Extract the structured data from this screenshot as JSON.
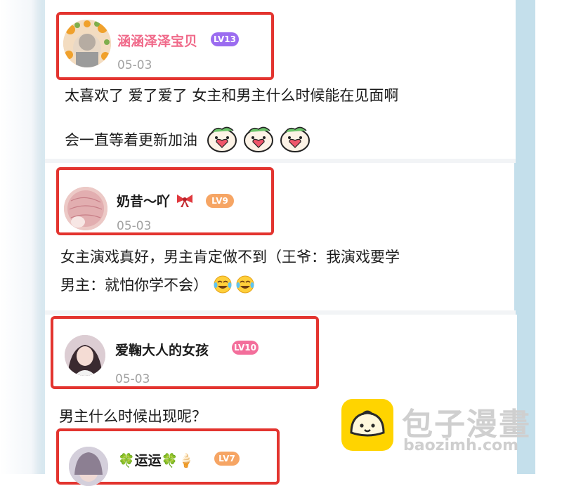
{
  "comments": [
    {
      "username": "涵涵泽泽宝贝",
      "level": "LV13",
      "date": "05-03",
      "lines": [
        "太喜欢了 爱了爱了 女主和男主什么时候能在见面啊",
        "会一直等着更新加油"
      ]
    },
    {
      "username": "奶昔～吖",
      "level": "LV9",
      "date": "05-03",
      "lines": [
        "女主演戏真好，男主肯定做不到（王爷：我演戏要学",
        "男主：就怕你学不会）"
      ]
    },
    {
      "username": "爱鞠大人的女孩",
      "level": "LV10",
      "date": "05-03",
      "lines": [
        "男主什么时候出现呢？"
      ]
    },
    {
      "username": "运运",
      "level": "LV7",
      "date": "",
      "lines": []
    }
  ],
  "watermark": {
    "name": "包子漫畫",
    "url": "baozimh.com"
  },
  "colors": {
    "highlight": "#e3342f",
    "name_pink": "#f06a8a",
    "lv_purple": "#9b6cf0",
    "lv_orange": "#f6a564",
    "lv_pink": "#f36e9b",
    "logo_yellow": "#ffd400"
  }
}
